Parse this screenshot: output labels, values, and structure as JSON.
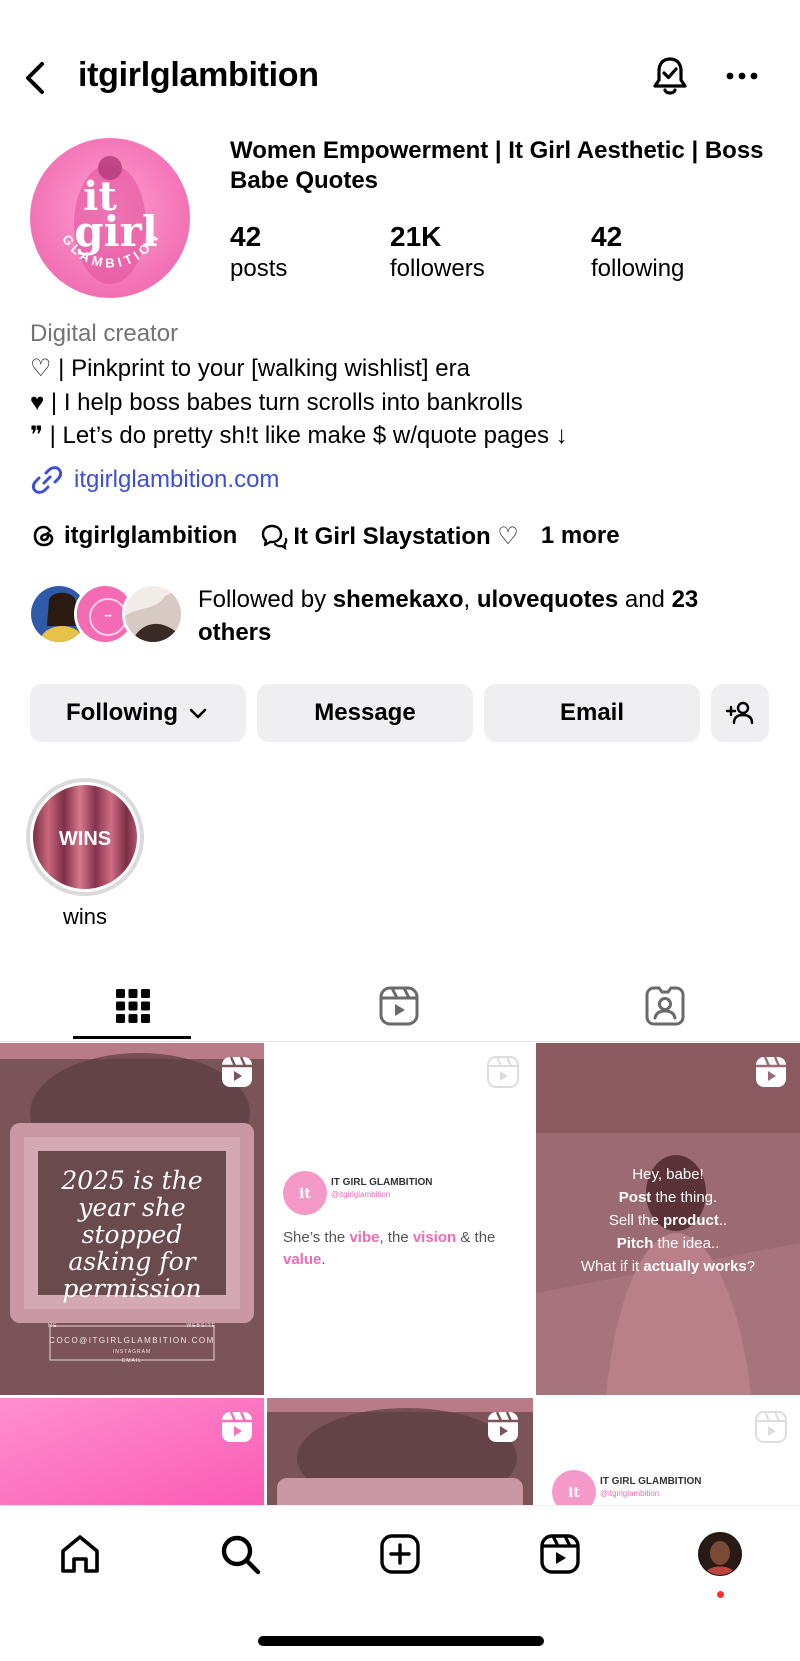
{
  "header": {
    "username": "itgirlglambition",
    "back_icon": "chevron-left-icon",
    "bell_icon": "bell-check-icon",
    "more_icon": "ellipsis-icon"
  },
  "profile": {
    "avatar_text_top": "it",
    "avatar_text_mid": "girl",
    "avatar_text_ring": "GLAMBITION",
    "name": "Women Empowerment | It Girl Aesthetic | Boss Babe Quotes",
    "stats": [
      {
        "value": "42",
        "label": "posts"
      },
      {
        "value": "21K",
        "label": "followers"
      },
      {
        "value": "42",
        "label": "following"
      }
    ],
    "category": "Digital creator",
    "bio": [
      "♡ | Pinkprint to your [walking wishlist] era",
      "♥ | I help boss babes turn scrolls into bankrolls",
      "❞ | Let’s do pretty sh!t like make $ w/quote pages ↓"
    ],
    "link": "itgirlglambition.com",
    "threads_handle": "itgirlglambition",
    "channel_name": "It Girl Slaystation ♡",
    "more_label": "1 more",
    "followed_by": {
      "prefix": "Followed by ",
      "user1": "shemekaxo",
      "sep": ", ",
      "user2": "ulovequotes",
      "mid": " and ",
      "others": "23 others"
    }
  },
  "buttons": {
    "following": "Following",
    "message": "Message",
    "email": "Email"
  },
  "highlights": [
    {
      "label": "wins",
      "cover_text": "WINS"
    }
  ],
  "grid": {
    "post1": {
      "lines": [
        "2025 is the",
        "year she stopped",
        "asking for",
        "permission"
      ],
      "footer1": "COCO@ITGIRLGLAMBITION.COM",
      "footer_me": "ME",
      "footer_web": "WEBSITE",
      "footer_ig": "INSTAGRAM",
      "footer_email": "EMAIL"
    },
    "post2": {
      "brand": "IT GIRL GLAMBITION",
      "handle": "@itgirlglambition",
      "t1": "She’s the ",
      "vibe": "vibe",
      "t2": ", the ",
      "vision": "vision",
      "t3": " & the",
      "value": "value",
      "t4": "."
    },
    "post3": {
      "l1": "Hey, babe!",
      "l2a": "Post",
      "l2b": " the thing.",
      "l3a": "Sell the ",
      "l3b": "product",
      "l3c": "..",
      "l4a": "Pitch",
      "l4b": " the idea..",
      "l5a": "What if it ",
      "l5b": "actually works",
      "l5c": "?"
    },
    "post6": {
      "brand": "IT GIRL GLAMBITION",
      "handle": "@itgirlglambition"
    }
  },
  "colors": {
    "link": "#3b4fd8",
    "pink": "#f06bb2",
    "button_bg": "#efeff2",
    "notification_dot": "#ff2d2d"
  }
}
